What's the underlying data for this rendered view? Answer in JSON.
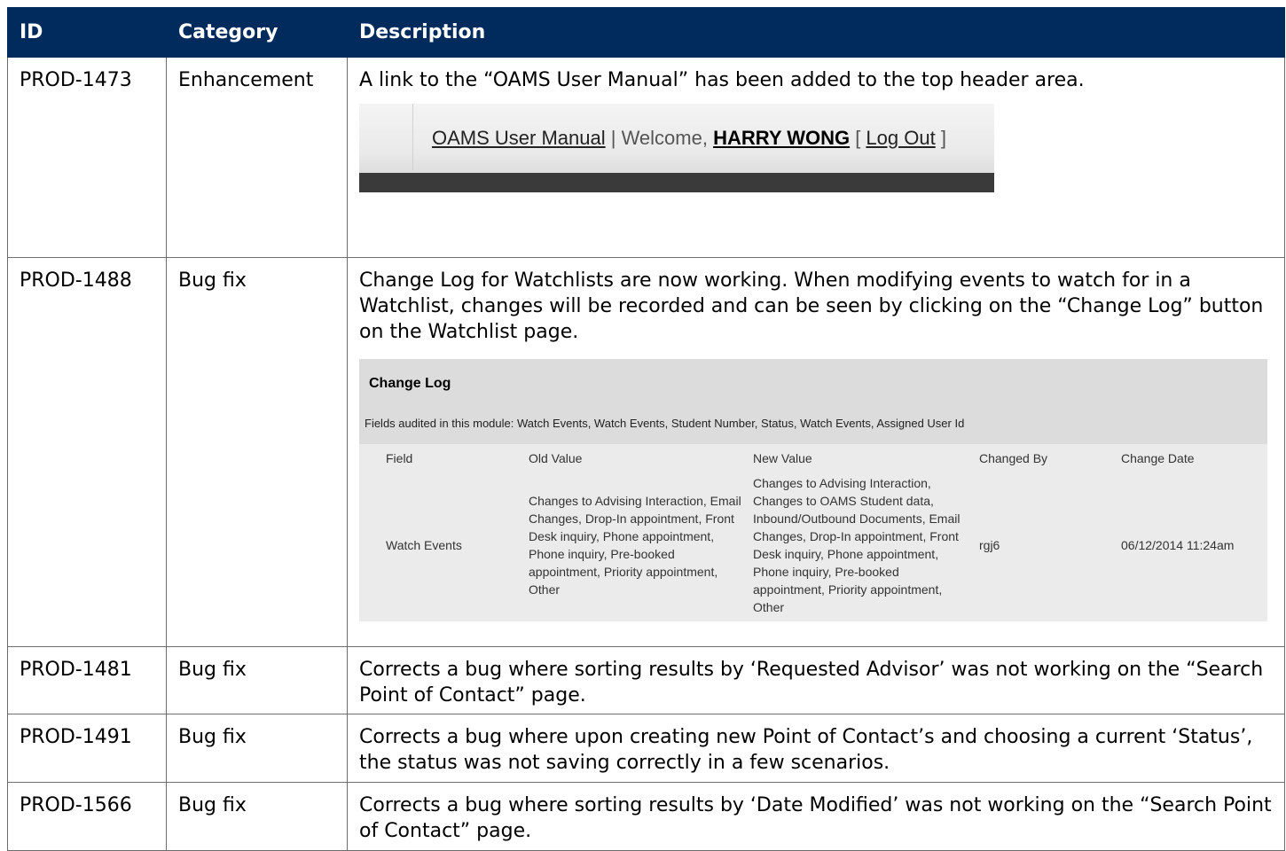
{
  "table": {
    "headers": [
      "ID",
      "Category",
      "Description"
    ],
    "rows": [
      {
        "id": "PROD-1473",
        "category": "Enhancement",
        "description": "A link to the “OAMS User Manual” has been added to the top header area.",
        "screenshot": {
          "manual_link": "OAMS User Manual",
          "separator": " | Welcome, ",
          "user": "HARRY WONG",
          "bracket_open": " [ ",
          "logout": "Log Out",
          "bracket_close": " ]"
        }
      },
      {
        "id": "PROD-1488",
        "category": "Bug fix",
        "description": "Change Log for Watchlists are now working. When modifying events to watch for in a Watchlist, changes will be recorded and can be seen by clicking on the “Change Log” button on the Watchlist page.",
        "screenshot": {
          "title": "Change Log",
          "fields_note": "Fields audited in this module: Watch Events, Watch Events, Student Number, Status, Watch Events, Assigned User Id",
          "columns": [
            "Field",
            "Old Value",
            "New Value",
            "Changed By",
            "Change Date"
          ],
          "entry": {
            "field": "Watch Events",
            "old_value": "Changes to Advising Interaction, Email Changes, Drop-In appointment, Front Desk inquiry, Phone appointment, Phone inquiry, Pre-booked appointment, Priority appointment, Other",
            "new_value": "Changes to Advising Interaction, Changes to OAMS Student data, Inbound/Outbound Documents, Email Changes, Drop-In appointment, Front Desk inquiry, Phone appointment, Phone inquiry, Pre-booked appointment, Priority appointment, Other",
            "changed_by": "rgj6",
            "change_date": "06/12/2014 11:24am"
          }
        }
      },
      {
        "id": "PROD-1481",
        "category": "Bug fix",
        "description": "Corrects a bug where sorting results by ‘Requested Advisor’ was not working on the “Search Point of Contact” page."
      },
      {
        "id": "PROD-1491",
        "category": "Bug fix",
        "description": "Corrects a bug where upon creating new Point of Contact’s and choosing a current ‘Status’, the status was not saving correctly in a few scenarios."
      },
      {
        "id": "PROD-1566",
        "category": "Bug fix",
        "description": "Corrects a bug where sorting results by ‘Date Modified’ was not working on the “Search Point of Contact” page."
      }
    ]
  }
}
